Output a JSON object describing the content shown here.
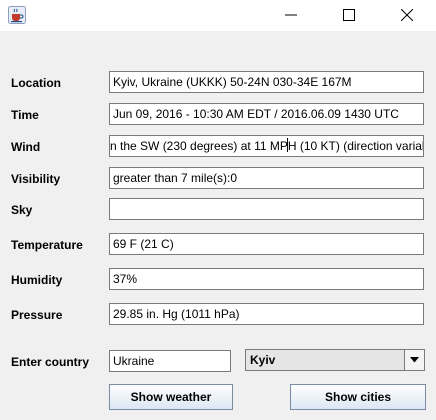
{
  "window": {
    "app_icon": "java-cup-icon",
    "controls": [
      "minimize-icon",
      "maximize-icon",
      "close-icon"
    ]
  },
  "fields": {
    "location": {
      "label": "Location",
      "value": "Kyiv, Ukraine (UKKK) 50-24N 030-34E 167M"
    },
    "time": {
      "label": "Time",
      "value": "Jun 09, 2016 - 10:30 AM EDT / 2016.06.09 1430 UTC"
    },
    "wind": {
      "label": "Wind",
      "value_before_caret": "n the SW (230 degrees) at 11 MP",
      "value_after_caret": "H (10 KT) (direction varial"
    },
    "visibility": {
      "label": "Visibility",
      "value": "greater than 7 mile(s):0"
    },
    "sky": {
      "label": "Sky",
      "value": ""
    },
    "temperature": {
      "label": "Temperature",
      "value": "69 F (21 C)"
    },
    "humidity": {
      "label": "Humidity",
      "value": "37%"
    },
    "pressure": {
      "label": "Pressure",
      "value": "29.85 in. Hg (1011 hPa)"
    }
  },
  "country": {
    "label": "Enter country",
    "value": "Ukraine",
    "city_selected": "Kyiv"
  },
  "buttons": {
    "show_weather": "Show weather",
    "show_cities": "Show cities"
  }
}
